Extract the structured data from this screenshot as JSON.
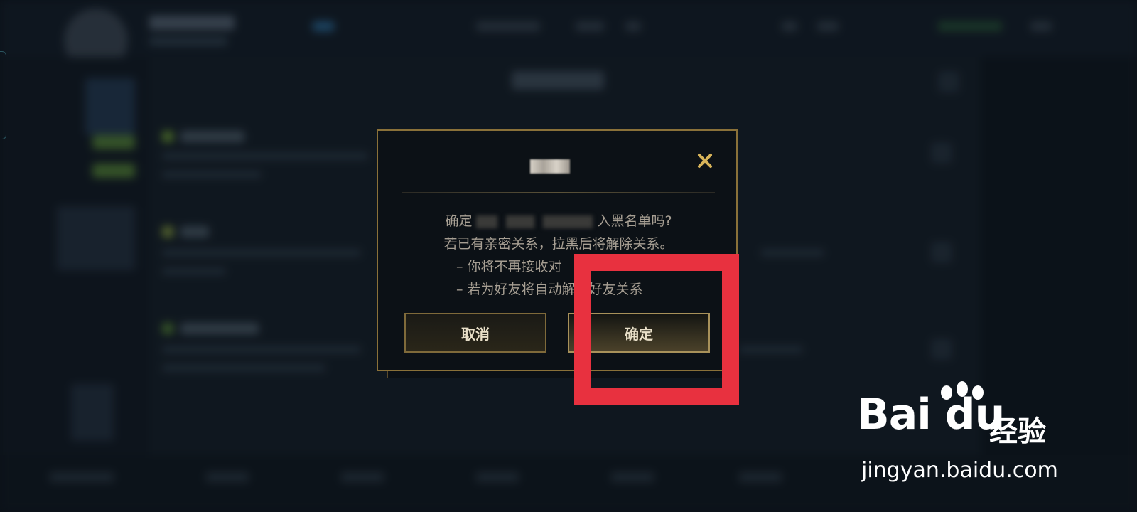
{
  "dialog": {
    "message_line1_prefix": "确定",
    "message_line1_suffix": "入黑名单吗?",
    "message_line2": "若已有亲密关系，拉黑后将解除关系。",
    "bullet1": "– 你将不再接收对",
    "bullet2": "– 若为好友将自动解除好友关系",
    "cancel_label": "取消",
    "confirm_label": "确定"
  },
  "colors": {
    "accent_gold": "#8a7139",
    "highlight_red": "#e8313f",
    "close_icon_gold": "#d8b45a"
  },
  "icons": {
    "close": "close-icon"
  },
  "watermark": {
    "logo_text": "Bai du",
    "sub_text": "经验",
    "url": "jingyan.baidu.com"
  }
}
